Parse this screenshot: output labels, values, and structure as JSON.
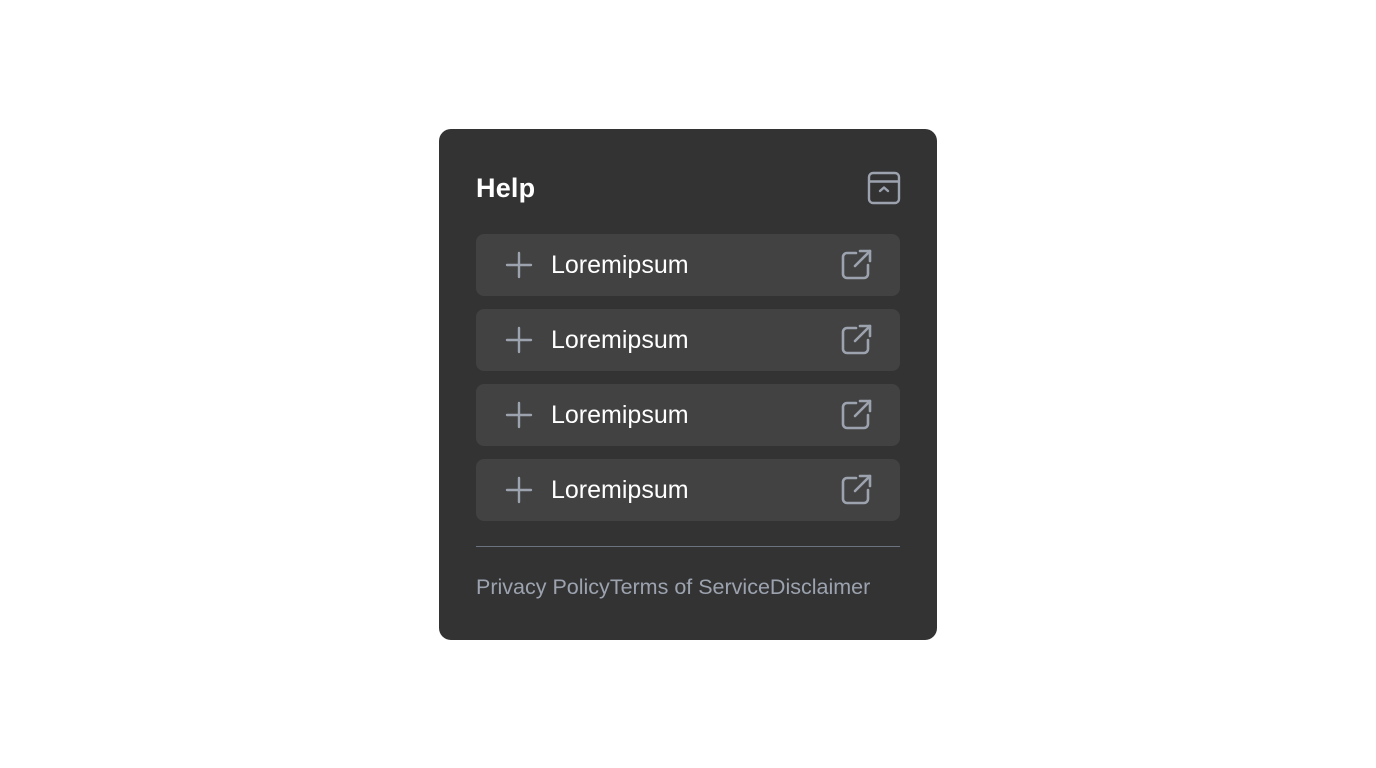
{
  "help_panel": {
    "title": "Help",
    "collapse_icon": "panel-collapse-icon",
    "items": [
      {
        "label": "Loremipsum",
        "leading_icon": "plus-icon",
        "trailing_icon": "external-link-icon"
      },
      {
        "label": "Loremipsum",
        "leading_icon": "plus-icon",
        "trailing_icon": "external-link-icon"
      },
      {
        "label": "Loremipsum",
        "leading_icon": "plus-icon",
        "trailing_icon": "external-link-icon"
      },
      {
        "label": "Loremipsum",
        "leading_icon": "plus-icon",
        "trailing_icon": "external-link-icon"
      }
    ],
    "footer_links": [
      "Privacy Policy",
      "Terms of Service",
      "Disclaimer"
    ]
  },
  "colors": {
    "page_background": "#ffffff",
    "panel_background": "#333333",
    "item_background": "#424242",
    "title_text": "#ffffff",
    "item_text": "#ffffff",
    "icon": "#9ca3af",
    "footer_text": "#9ca3af",
    "divider": "#6b7280"
  }
}
